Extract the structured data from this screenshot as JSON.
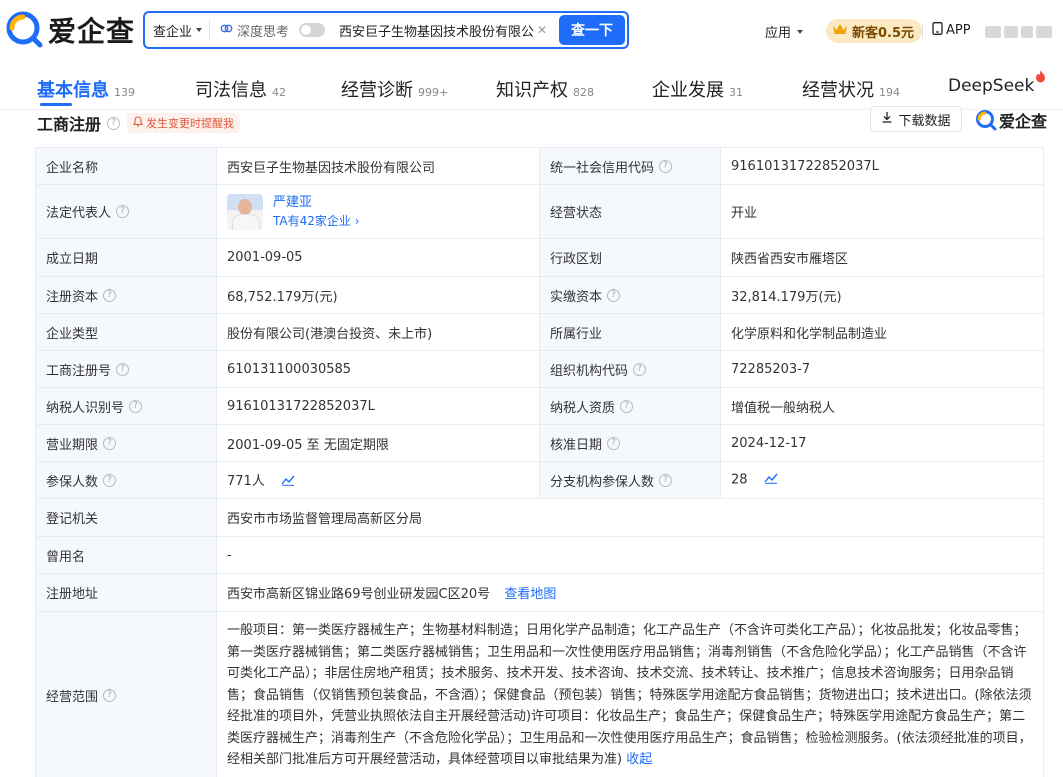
{
  "header": {
    "logo_text": "爱企查",
    "search_scope": "查企业",
    "deep_think_label": "深度思考",
    "search_query": "西安巨子生物基因技术股份有限公司",
    "search_button": "查一下",
    "apps_label": "应用",
    "vip_label": "新客0.5元",
    "app_label": "APP"
  },
  "tabs": [
    {
      "label": "基本信息",
      "count": "139"
    },
    {
      "label": "司法信息",
      "count": "42"
    },
    {
      "label": "经营诊断",
      "count": "999+"
    },
    {
      "label": "知识产权",
      "count": "828"
    },
    {
      "label": "企业发展",
      "count": "31"
    },
    {
      "label": "经营状况",
      "count": "194"
    },
    {
      "label": "DeepSeek",
      "count": ""
    }
  ],
  "section": {
    "title": "工商注册",
    "remind_label": "发生变更时提醒我",
    "download_label": "下载数据",
    "brand": "爱企查"
  },
  "fields": {
    "company_name_label": "企业名称",
    "company_name": "西安巨子生物基因技术股份有限公司",
    "credit_code_label": "统一社会信用代码",
    "credit_code": "91610131722852037L",
    "legal_rep_label": "法定代表人",
    "legal_rep_name": "严建亚",
    "legal_rep_companies": "TA有42家企业",
    "status_label": "经营状态",
    "status": "开业",
    "founded_label": "成立日期",
    "founded": "2001-09-05",
    "region_label": "行政区划",
    "region": "陕西省西安市雁塔区",
    "reg_capital_label": "注册资本",
    "reg_capital": "68,752.179万(元)",
    "paid_capital_label": "实缴资本",
    "paid_capital": "32,814.179万(元)",
    "company_type_label": "企业类型",
    "company_type": "股份有限公司(港澳台投资、未上市)",
    "industry_label": "所属行业",
    "industry": "化学原料和化学制品制造业",
    "reg_no_label": "工商注册号",
    "reg_no": "610131100030585",
    "org_code_label": "组织机构代码",
    "org_code": "72285203-7",
    "taxpayer_id_label": "纳税人识别号",
    "taxpayer_id": "91610131722852037L",
    "taxpayer_qual_label": "纳税人资质",
    "taxpayer_qual": "增值税一般纳税人",
    "term_label": "营业期限",
    "term": "2001-09-05 至 无固定期限",
    "approve_date_label": "核准日期",
    "approve_date": "2024-12-17",
    "insured_label": "参保人数",
    "insured": "771人",
    "branch_insured_label": "分支机构参保人数",
    "branch_insured": "28",
    "authority_label": "登记机关",
    "authority": "西安市市场监督管理局高新区分局",
    "former_name_label": "曾用名",
    "former_name": "-",
    "address_label": "注册地址",
    "address": "西安市高新区锦业路69号创业研发园C区20号",
    "map_link": "查看地图",
    "scope_label": "经营范围",
    "scope": "一般项目：第一类医疗器械生产；生物基材料制造；日用化学产品制造；化工产品生产（不含许可类化工产品）；化妆品批发；化妆品零售；第一类医疗器械销售；第二类医疗器械销售；卫生用品和一次性使用医疗用品销售；消毒剂销售（不含危险化学品）；化工产品销售（不含许可类化工产品）；非居住房地产租赁；技术服务、技术开发、技术咨询、技术交流、技术转让、技术推广；信息技术咨询服务；日用杂品销售；食品销售（仅销售预包装食品，不含酒）；保健食品（预包装）销售；特殊医学用途配方食品销售；货物进出口；技术进出口。(除依法须经批准的项目外，凭营业执照依法自主开展经营活动)许可项目：化妆品生产；食品生产；保健食品生产；特殊医学用途配方食品生产；第二类医疗器械生产；消毒剂生产（不含危险化学品）；卫生用品和一次性使用医疗用品生产；食品销售；检验检测服务。(依法须经批准的项目，经相关部门批准后方可开展经营活动，具体经营项目以审批结果为准)",
    "collapse_link": "收起"
  },
  "colors": {
    "accent": "#1e6cf7",
    "label_bg": "#f5f8fd",
    "border": "#e9ecf2",
    "vip_bg": "#fbe9c4",
    "remind": "#e0573a"
  }
}
